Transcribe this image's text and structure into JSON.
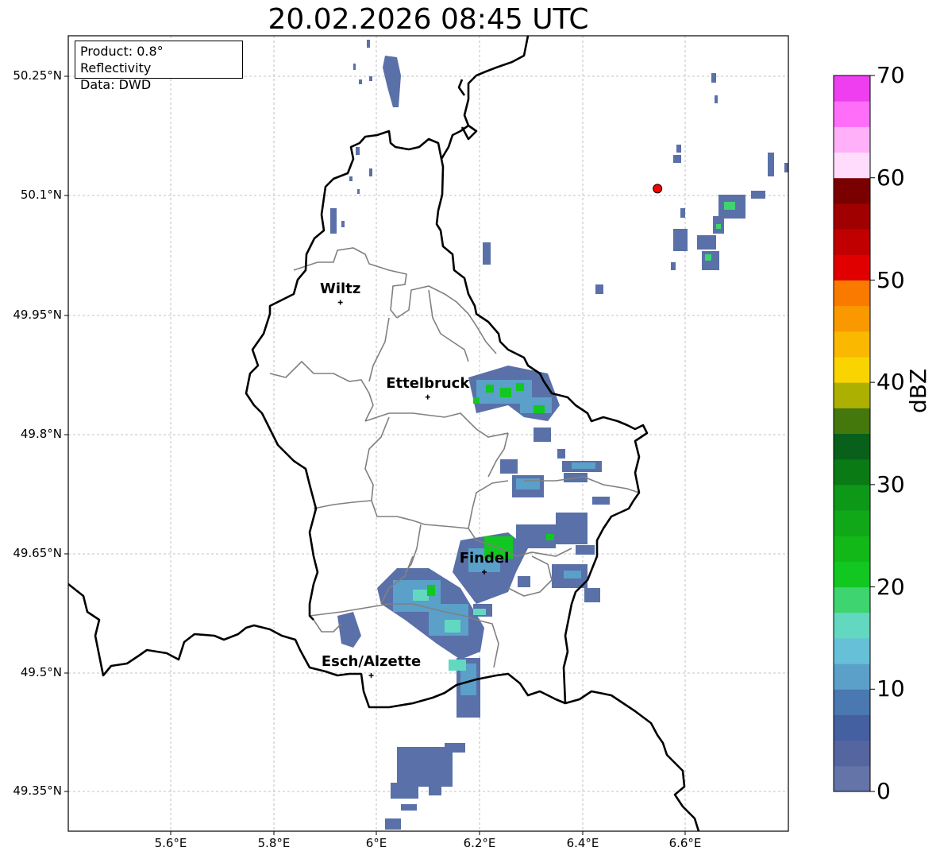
{
  "title": "20.02.2026 08:45 UTC",
  "info": {
    "product": "Product: 0.8° Reflectivity",
    "data": "Data: DWD"
  },
  "map": {
    "lon_range": [
      5.4,
      6.8
    ],
    "lat_range": [
      49.3,
      50.3
    ],
    "lat_ticks": [
      "50.25°N",
      "50.1°N",
      "49.95°N",
      "49.8°N",
      "49.65°N",
      "49.5°N",
      "49.35°N"
    ],
    "lon_ticks": [
      "5.6°E",
      "5.8°E",
      "6°E",
      "6.2°E",
      "6.4°E",
      "6.6°E"
    ],
    "cities": [
      {
        "name": "Wiltz",
        "lon": 5.93,
        "lat": 49.966
      },
      {
        "name": "Ettelbruck",
        "lon": 6.1,
        "lat": 49.847
      },
      {
        "name": "Findel",
        "lon": 6.21,
        "lat": 49.627
      },
      {
        "name": "Esch/Alzette",
        "lon": 5.99,
        "lat": 49.497
      }
    ],
    "radar_marker": {
      "lon": 6.547,
      "lat": 50.109,
      "color": "#ff0000"
    }
  },
  "colorbar": {
    "label": "dBZ",
    "ticks": [
      "0",
      "10",
      "20",
      "30",
      "40",
      "50",
      "60",
      "70"
    ],
    "colors": [
      "#6574a8",
      "#5565a0",
      "#4560a0",
      "#4a78b0",
      "#5aa0c8",
      "#66c0d8",
      "#62d8c0",
      "#3ed470",
      "#12c820",
      "#12b818",
      "#10a818",
      "#0e9818",
      "#0a7a14",
      "#08601a",
      "#44780c",
      "#acb000",
      "#fad400",
      "#fab800",
      "#fa9800",
      "#fa7a00",
      "#e00000",
      "#c00000",
      "#a00000",
      "#7a0000",
      "#ffdcfc",
      "#ffb0f8",
      "#ff6ef8",
      "#ee3ef0"
    ]
  }
}
